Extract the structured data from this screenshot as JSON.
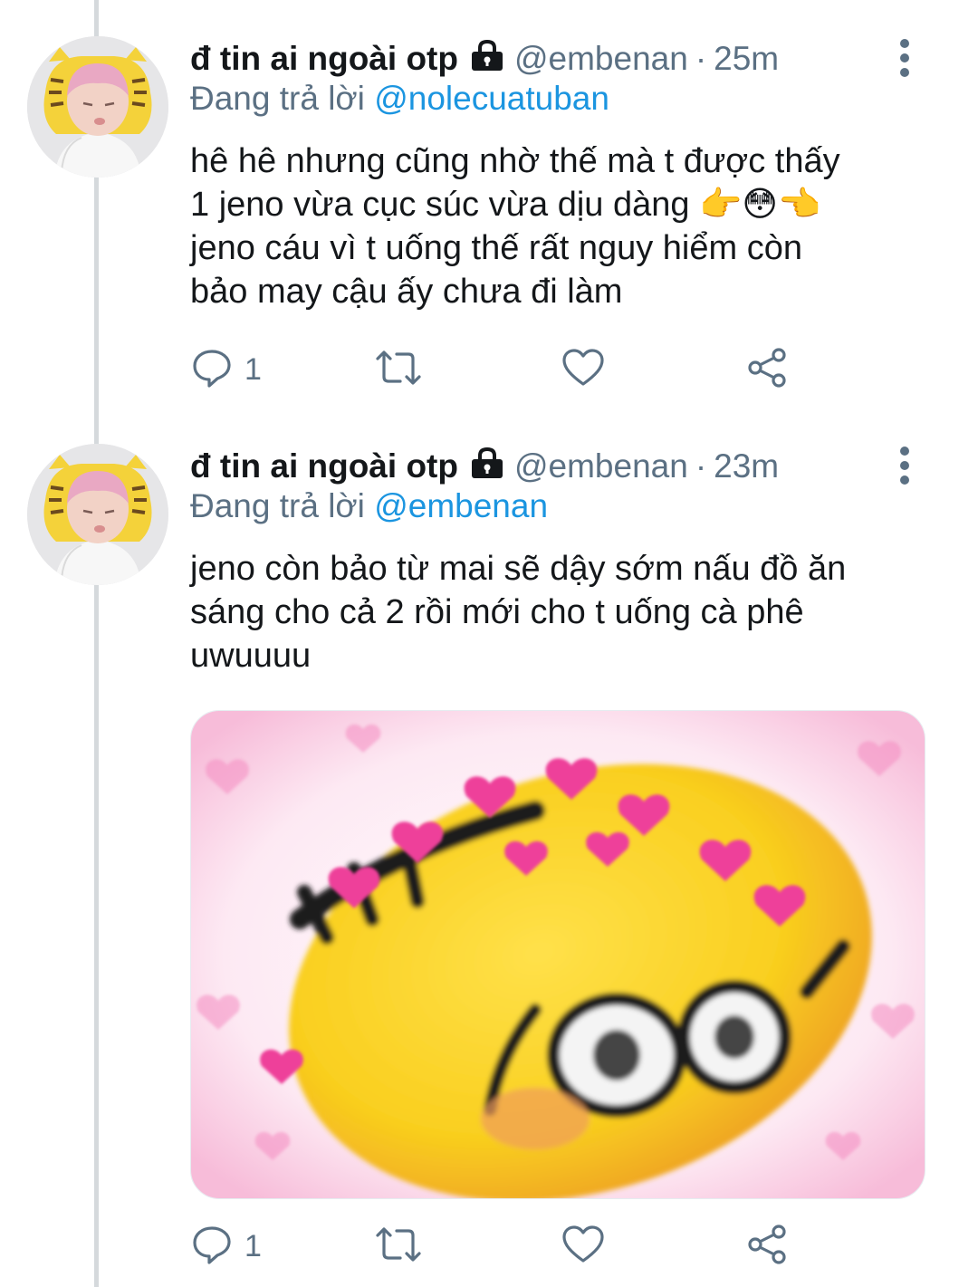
{
  "tweets": [
    {
      "author_name": "đ tin ai ngoài otp",
      "handle": "@embenan",
      "separator": "·",
      "time": "25m",
      "replying_prefix": "Đang trả lời",
      "replying_to": "@nolecuatuban",
      "text_lines": [
        "hê hê nhưng cũng nhờ thế mà t được thấy",
        "1 jeno vừa cục súc vừa dịu dàng 👉😳👈",
        "jeno cáu vì t uống thế rất nguy hiểm còn",
        "bảo may cậu ấy chưa đi làm"
      ],
      "reply_count": "1",
      "icons": [
        "lock-icon",
        "more-icon",
        "reply-icon",
        "retweet-icon",
        "like-icon",
        "share-icon"
      ]
    },
    {
      "author_name": "đ tin ai ngoài otp",
      "handle": "@embenan",
      "separator": "·",
      "time": "23m",
      "replying_prefix": "Đang trả lời",
      "replying_to": "@embenan",
      "text_lines": [
        "jeno còn bảo từ mai sẽ dậy sớm nấu đồ ăn",
        "sáng cho cả 2 rồi mới cho t uống cà phê",
        "uwuuuu"
      ],
      "reply_count": "1",
      "media": "blushing emoji with hearts",
      "icons": [
        "lock-icon",
        "more-icon",
        "reply-icon",
        "retweet-icon",
        "like-icon",
        "share-icon"
      ]
    }
  ],
  "colors": {
    "text": "#14171a",
    "secondary": "#5b7083",
    "link": "#1b95e0",
    "thread_line": "#d5d9dc"
  }
}
